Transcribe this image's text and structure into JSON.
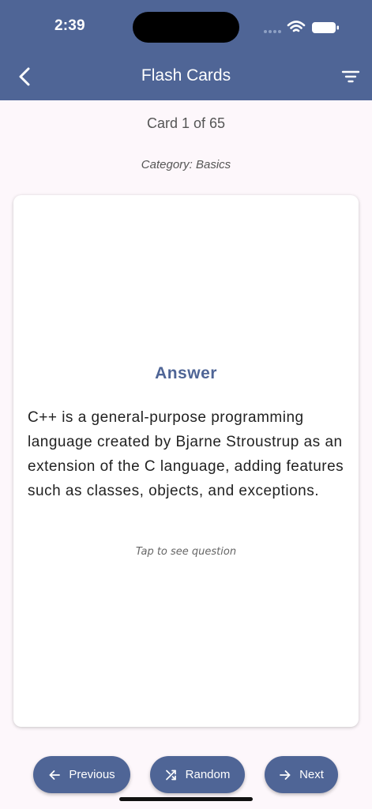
{
  "status_bar": {
    "time": "2:39"
  },
  "header": {
    "title": "Flash Cards",
    "back_icon": "chevron-left-icon",
    "filter_icon": "filter-icon"
  },
  "progress": {
    "card_count": "Card 1 of 65"
  },
  "category": {
    "label": "Category: Basics"
  },
  "card": {
    "heading": "Answer",
    "text": "C++ is a general-purpose programming language created by Bjarne Stroustrup as an extension of the C language, adding features such as classes, objects, and exceptions.",
    "hint": "Tap to see question"
  },
  "navigation": {
    "previous_label": "Previous",
    "random_label": "Random",
    "next_label": "Next"
  },
  "colors": {
    "primary": "#4f6596",
    "background": "#fdf7fb",
    "card": "#ffffff"
  }
}
